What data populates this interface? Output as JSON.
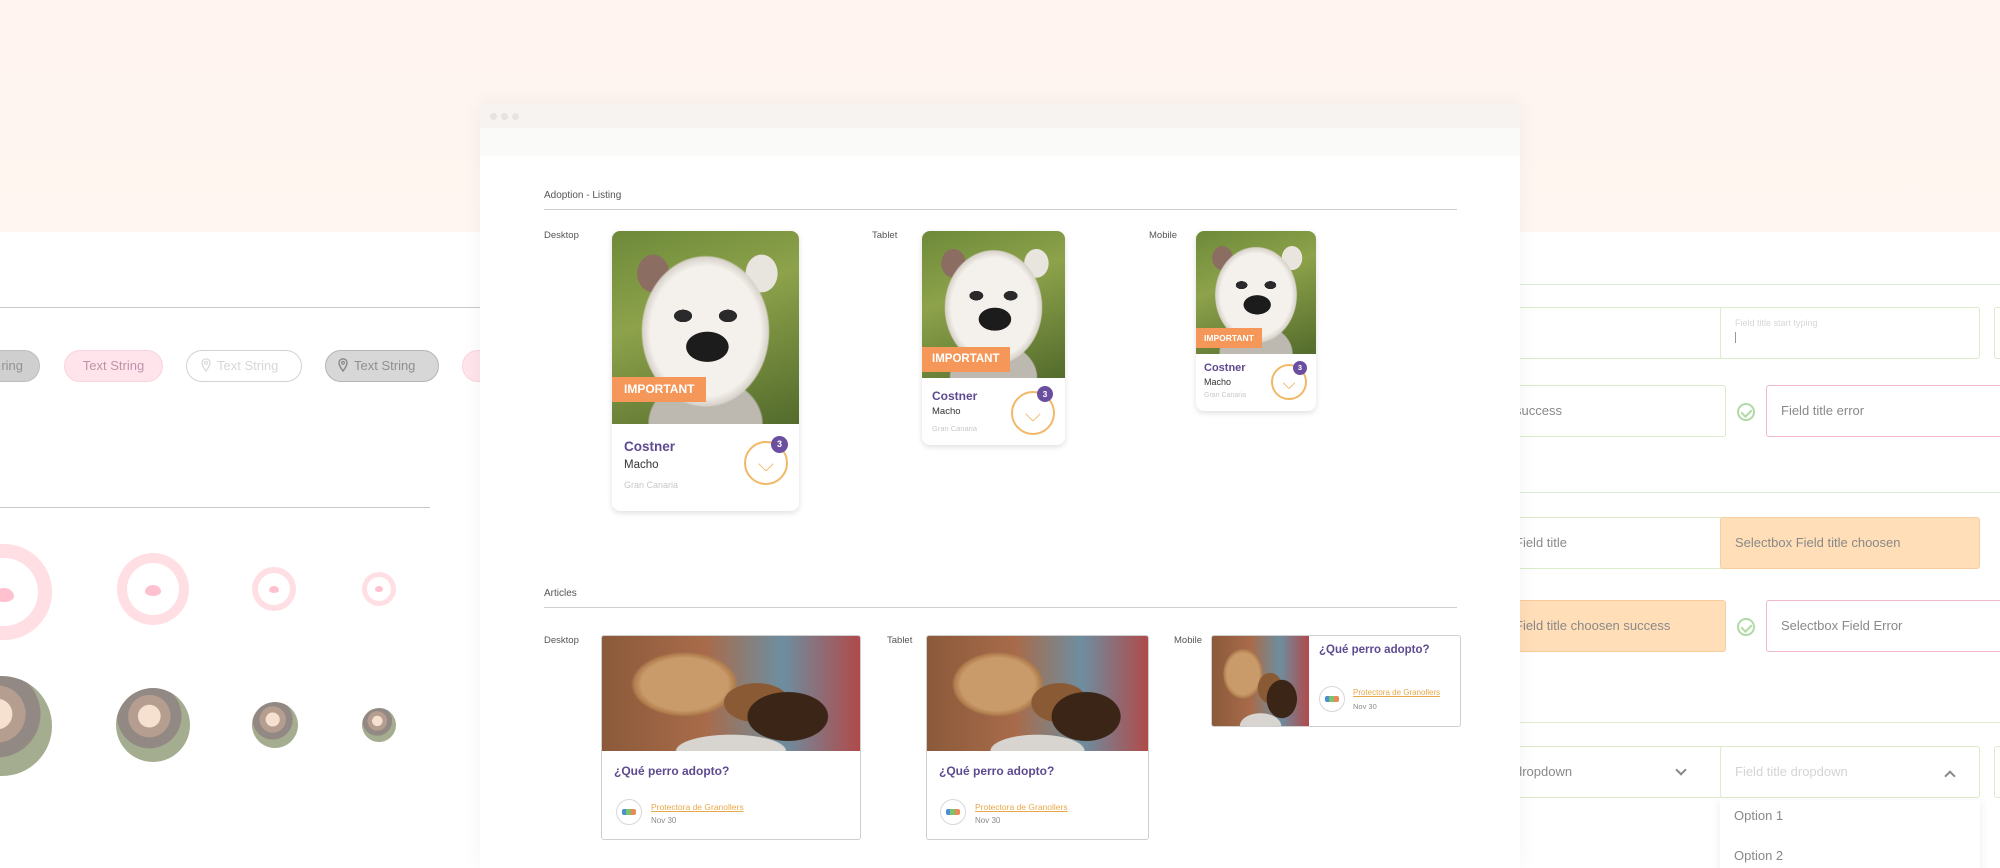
{
  "left_panel": {
    "chips": [
      "ring",
      "Text String",
      "Text String",
      "Text String"
    ]
  },
  "right_panel": {
    "fields": {
      "typing_placeholder": "Field title start typing",
      "success_value": "success",
      "error_value": "Field title error",
      "select_value": "Field title",
      "select_chosen": "Selectbox Field title choosen",
      "select_chosen_success": "Field title choosen success",
      "select_error": "Selectbox Field Error",
      "dropdown_value": "dropdown",
      "dropdown_placeholder": "Field title dropdown"
    },
    "dropdown_options": [
      "Option 1",
      "Option 2"
    ]
  },
  "window": {
    "adoption": {
      "section_title": "Adoption - Listing",
      "labels": {
        "desktop": "Desktop",
        "tablet": "Tablet",
        "mobile": "Mobile"
      },
      "pet": {
        "badge": "IMPORTANT",
        "name": "Costner",
        "sex": "Macho",
        "location": "Gran Canaria",
        "favorites": "3"
      }
    },
    "articles": {
      "section_title": "Articles",
      "labels": {
        "desktop": "Desktop",
        "tablet": "Tablet",
        "mobile": "Mobile"
      },
      "article": {
        "title": "¿Qué perro adopto?",
        "org": "Protectora de Granollers",
        "date": "Nov 30"
      }
    }
  },
  "colors": {
    "brand_purple": "#5e4a8f",
    "accent_orange": "#f49758",
    "heart_gold": "#f0b867",
    "pink": "#ffc4cf"
  }
}
